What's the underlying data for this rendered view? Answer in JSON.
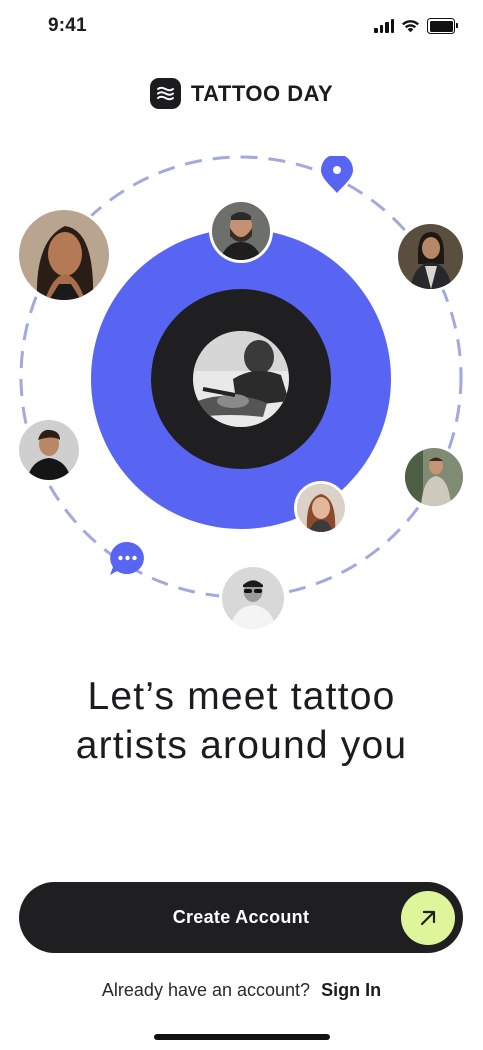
{
  "status_bar": {
    "time": "9:41",
    "icons": [
      "signal-icon",
      "wifi-icon",
      "battery-icon"
    ]
  },
  "brand": {
    "name": "TATTOO DAY",
    "logo_icon": "wave-logo-icon"
  },
  "illustration": {
    "accent_color": "#5865f2",
    "dark_color": "#1f1f21",
    "orbit_color": "#a3a8de",
    "badges": [
      "location-pin-icon",
      "chat-bubble-icon"
    ],
    "avatars": [
      "artist-woman",
      "artist-bearded-man",
      "artist-man-long-hair",
      "artist-young-man",
      "artist-man-tshirt",
      "artist-woman-red-hair",
      "artist-man-sunglasses",
      "tattooing-in-progress"
    ]
  },
  "headline": {
    "line1": "Let’s meet tattoo",
    "line2": "artists around you"
  },
  "cta": {
    "label": "Create Account",
    "arrow_icon": "arrow-up-right-icon",
    "accent_color": "#dff59a"
  },
  "signin": {
    "prompt": "Already have an account?",
    "link": "Sign In"
  }
}
